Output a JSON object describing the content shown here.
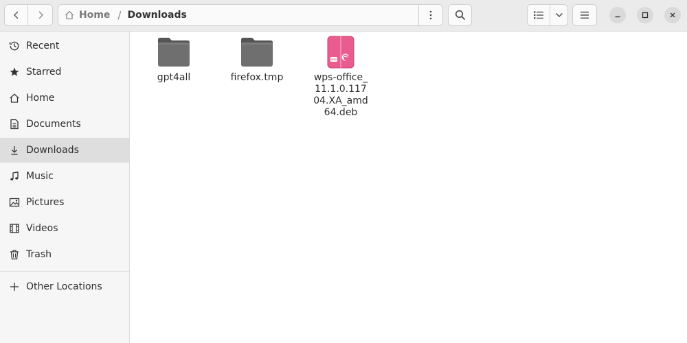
{
  "header": {
    "back_icon": "chevron-left-icon",
    "forward_icon": "chevron-right-icon",
    "path": {
      "home_label": "Home",
      "separator": "/",
      "current_label": "Downloads"
    },
    "path_menu_icon": "kebab-menu-icon",
    "search_icon": "search-icon",
    "view_list_icon": "list-view-icon",
    "view_options_icon": "chevron-down-icon",
    "main_menu_icon": "hamburger-menu-icon",
    "window_controls": [
      "minimize-icon",
      "maximize-icon",
      "close-icon"
    ]
  },
  "sidebar": {
    "items": [
      {
        "label": "Recent",
        "icon": "clock-icon"
      },
      {
        "label": "Starred",
        "icon": "star-icon"
      },
      {
        "label": "Home",
        "icon": "home-icon"
      },
      {
        "label": "Documents",
        "icon": "document-icon"
      },
      {
        "label": "Downloads",
        "icon": "download-icon",
        "active": true
      },
      {
        "label": "Music",
        "icon": "music-icon"
      },
      {
        "label": "Pictures",
        "icon": "picture-icon"
      },
      {
        "label": "Videos",
        "icon": "video-icon"
      },
      {
        "label": "Trash",
        "icon": "trash-icon"
      }
    ],
    "other_locations": {
      "label": "Other Locations",
      "icon": "plus-icon"
    }
  },
  "files": [
    {
      "name": "gpt4all",
      "type": "folder",
      "icon": "folder-icon"
    },
    {
      "name": "firefox.tmp",
      "type": "folder",
      "icon": "folder-icon"
    },
    {
      "name": "wps-office_11.1.0.11704.XA_amd64.deb",
      "type": "deb-package",
      "icon": "deb-package-icon"
    }
  ],
  "colors": {
    "headerbar": "#ebebeb",
    "sidebar": "#f6f6f6",
    "sidebar_active": "#dedede",
    "folder": "#6d6d6d",
    "deb_package": "#ea5b8e"
  }
}
